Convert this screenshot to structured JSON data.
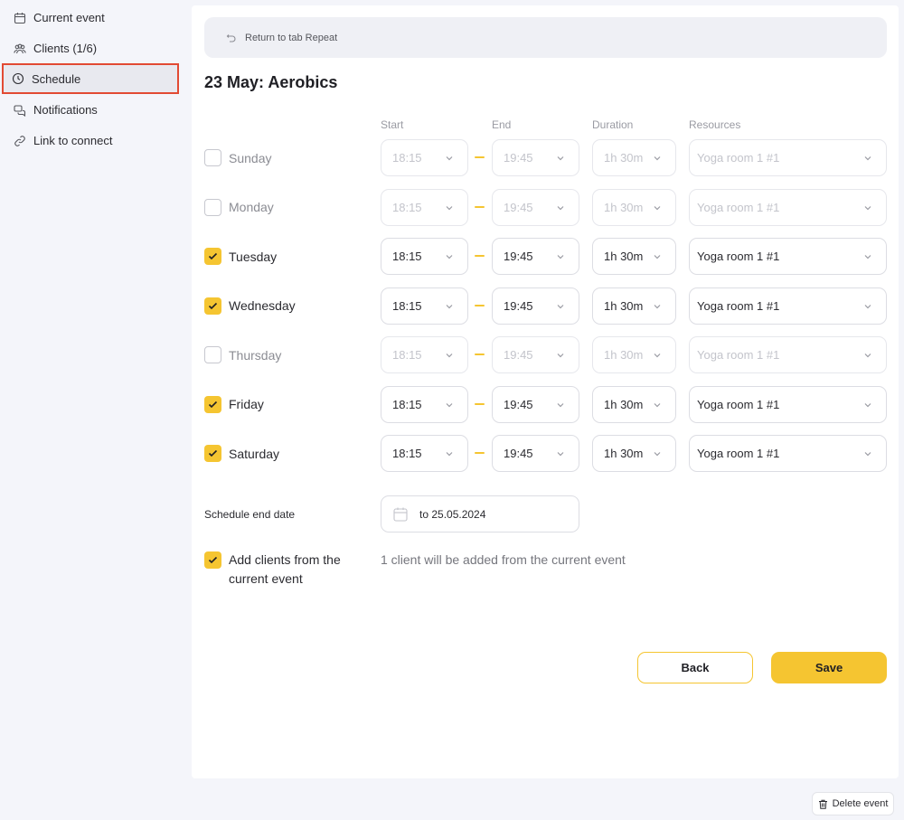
{
  "sidebar": {
    "items": [
      {
        "label": "Current event",
        "icon": "calendar-icon"
      },
      {
        "label": "Clients (1/6)",
        "icon": "users-icon"
      },
      {
        "label": "Schedule",
        "icon": "clock-icon",
        "active": true
      },
      {
        "label": "Notifications",
        "icon": "chat-icon"
      },
      {
        "label": "Link to connect",
        "icon": "link-icon"
      }
    ]
  },
  "main": {
    "return_label": "Return to tab Repeat",
    "title": "23 May: Aerobics",
    "columns": {
      "start": "Start",
      "end": "End",
      "duration": "Duration",
      "resources": "Resources"
    },
    "days": [
      {
        "name": "Sunday",
        "checked": false,
        "start": "18:15",
        "end": "19:45",
        "duration": "1h 30m",
        "resource": "Yoga room 1 #1"
      },
      {
        "name": "Monday",
        "checked": false,
        "start": "18:15",
        "end": "19:45",
        "duration": "1h 30m",
        "resource": "Yoga room 1 #1"
      },
      {
        "name": "Tuesday",
        "checked": true,
        "start": "18:15",
        "end": "19:45",
        "duration": "1h 30m",
        "resource": "Yoga room 1 #1"
      },
      {
        "name": "Wednesday",
        "checked": true,
        "start": "18:15",
        "end": "19:45",
        "duration": "1h 30m",
        "resource": "Yoga room 1 #1"
      },
      {
        "name": "Thursday",
        "checked": false,
        "start": "18:15",
        "end": "19:45",
        "duration": "1h 30m",
        "resource": "Yoga room 1 #1"
      },
      {
        "name": "Friday",
        "checked": true,
        "start": "18:15",
        "end": "19:45",
        "duration": "1h 30m",
        "resource": "Yoga room 1 #1"
      },
      {
        "name": "Saturday",
        "checked": true,
        "start": "18:15",
        "end": "19:45",
        "duration": "1h 30m",
        "resource": "Yoga room 1 #1"
      }
    ],
    "end_date_label": "Schedule end date",
    "end_date_value": "to 25.05.2024",
    "add_clients": {
      "checked": true,
      "label": "Add clients from the current event"
    },
    "clients_note": "1 client will be added from the current event",
    "back_label": "Back",
    "save_label": "Save"
  },
  "delete_label": "Delete event",
  "colors": {
    "accent": "#f5c531",
    "highlight_border": "#e24a33"
  }
}
